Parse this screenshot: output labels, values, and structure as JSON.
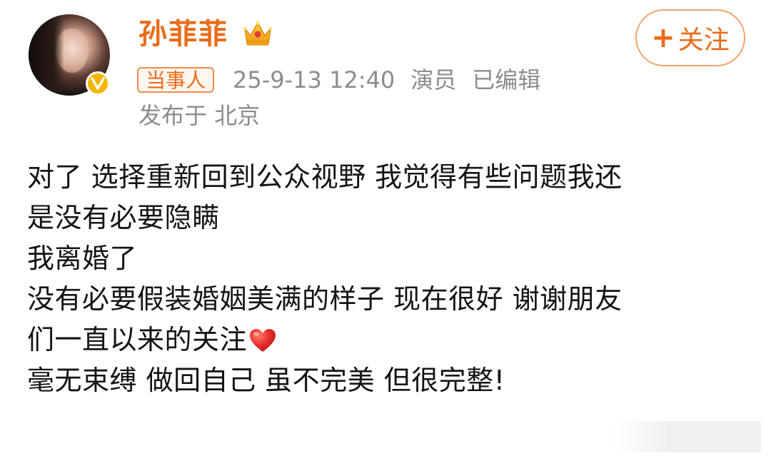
{
  "author": {
    "name": "孙菲菲",
    "avatar_icon": "avatar-portrait",
    "verified_icon": "verified-v-badge",
    "crown_icon": "crown-icon"
  },
  "follow_button": {
    "plus": "+",
    "label": "关注"
  },
  "meta": {
    "tag": "当事人",
    "datetime": "25-9-13 12:40",
    "occupation": "演员",
    "edited": "已编辑",
    "location": "发布于 北京"
  },
  "content": {
    "lines": [
      "对了 选择重新回到公众视野 我觉得有些问题我还",
      "是没有必要隐瞒",
      "我离婚了",
      "没有必要假装婚姻美满的样子 现在很好 谢谢朋友",
      "们一直以来的关注",
      "毫无束缚 做回自己 虽不完美 但很完整!"
    ],
    "heart_icon": "red-heart-emoji"
  },
  "colors": {
    "accent_orange": "#ea6b17",
    "meta_gray": "#8c8c8c",
    "text_dark": "#141414",
    "badge_gold": "#f5b400",
    "heart_red": "#e5312b"
  }
}
